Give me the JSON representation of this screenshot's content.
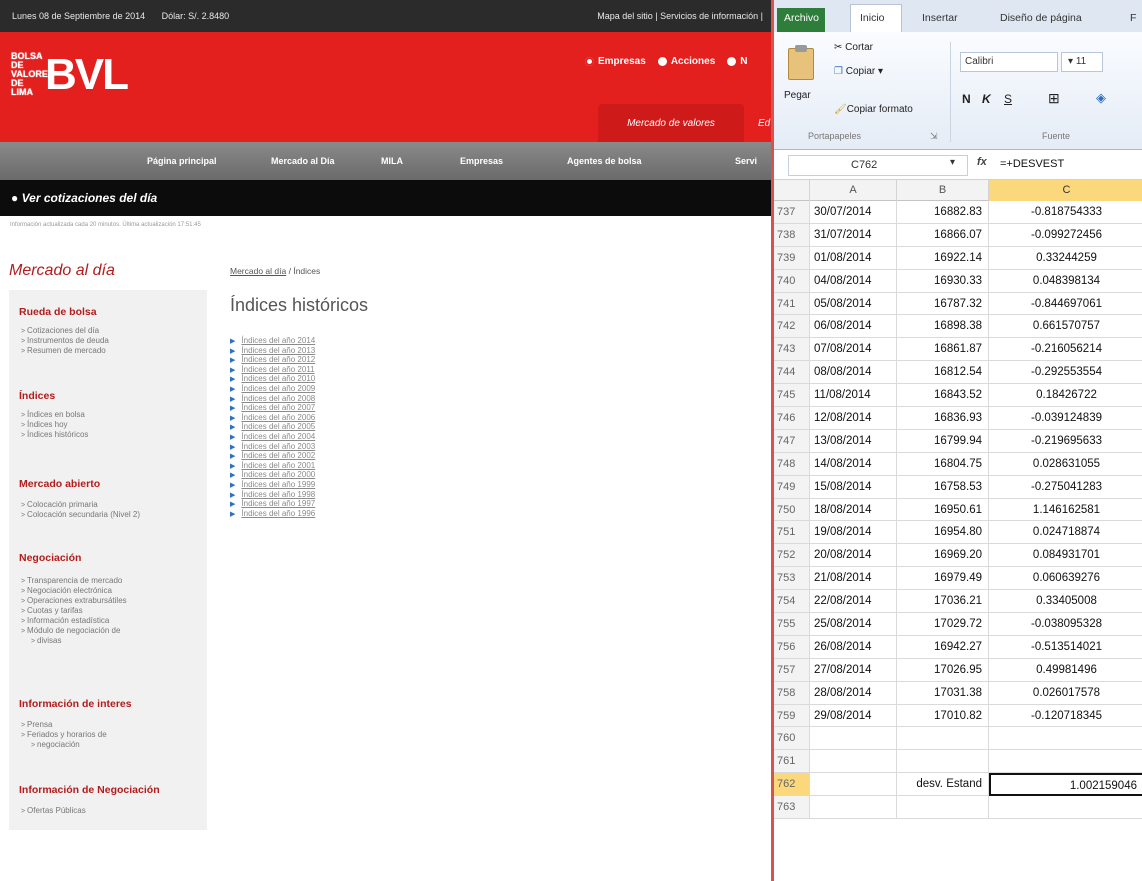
{
  "bvl": {
    "topbar": {
      "date": "Lunes 08 de Septiembre de 2014",
      "dolar": "Dólar: S/. 2.8480",
      "links": "Mapa del sitio  |  Servicios de información  |"
    },
    "logo": {
      "small": "BOLSA DE VALORES DE LIMA",
      "big": "BVL"
    },
    "radios": [
      "Empresas",
      "Acciones",
      "N"
    ],
    "tabs": {
      "active": "Mercado de valores",
      "next": "Ed"
    },
    "nav": [
      "Página principal",
      "Mercado al Día",
      "MILA",
      "Empresas",
      "Agentes de bolsa",
      "Servi"
    ],
    "banner": "Ver cotizaciones del día",
    "update_note": "Información actualizada cada 20 minutos. Última actualización 17:51:45",
    "side_title": "Mercado al día",
    "sections": [
      {
        "title": "Rueda de bolsa",
        "items": [
          "Cotizaciones del día",
          "Instrumentos de deuda",
          "Resumen de mercado"
        ]
      },
      {
        "title": "Índices",
        "items": [
          "Índices en bolsa",
          "Índices hoy",
          "Índices históricos"
        ]
      },
      {
        "title": "Mercado abierto",
        "items": [
          "Colocación primaria",
          "Colocación secundaria (Nivel 2)"
        ]
      },
      {
        "title": "Negociación",
        "items": [
          "Transparencia de mercado",
          "Negociación electrónica",
          "Operaciones extrabursátiles",
          "Cuotas y tarifas",
          "Información estadística",
          "Módulo de negociación de",
          "divisas"
        ]
      },
      {
        "title": "Información de interes",
        "items": [
          "Prensa",
          "Feriados y horarios de",
          "negociación"
        ]
      },
      {
        "title": "Información de Negociación",
        "items": [
          "Ofertas Públicas"
        ]
      }
    ],
    "breadcrumb": {
      "link": "Mercado al día",
      "sep": " / ",
      "current": "Índices"
    },
    "page_title": "Índices históricos",
    "years": [
      "Índices del año 2014",
      "Índices del año 2013",
      "Índices del año 2012",
      "Índices del año 2011",
      "Índices del año 2010",
      "Índices del año 2009",
      "Índices del año 2008",
      "Índices del año 2007",
      "Índices del año 2006",
      "Índices del año 2005",
      "Índices del año 2004",
      "Índices del año 2003",
      "Índices del año 2002",
      "Índices del año 2001",
      "Índices del año 2000",
      "Índices del año 1999",
      "Índices del año 1998",
      "Índices del año 1997",
      "Índices del año 1996"
    ]
  },
  "excel": {
    "tabs": [
      "Archivo",
      "Inicio",
      "Insertar",
      "Diseño de página",
      "F"
    ],
    "clipboard": {
      "paste": "Pegar",
      "cut": "Cortar",
      "copy": "Copiar",
      "format": "Copiar formato",
      "group": "Portapapeles"
    },
    "font": {
      "name": "Calibri",
      "size": "11",
      "group": "Fuente",
      "bold": "N",
      "italic": "K",
      "underline": "S"
    },
    "namebox": "C762",
    "fx": "fx",
    "formula": "=+DESVEST",
    "columns": [
      "A",
      "B",
      "C"
    ],
    "rows": [
      {
        "n": "737",
        "a": "30/07/2014",
        "b": "16882.83",
        "c": "-0.818754333"
      },
      {
        "n": "738",
        "a": "31/07/2014",
        "b": "16866.07",
        "c": "-0.099272456"
      },
      {
        "n": "739",
        "a": "01/08/2014",
        "b": "16922.14",
        "c": "0.33244259"
      },
      {
        "n": "740",
        "a": "04/08/2014",
        "b": "16930.33",
        "c": "0.048398134"
      },
      {
        "n": "741",
        "a": "05/08/2014",
        "b": "16787.32",
        "c": "-0.844697061"
      },
      {
        "n": "742",
        "a": "06/08/2014",
        "b": "16898.38",
        "c": "0.661570757"
      },
      {
        "n": "743",
        "a": "07/08/2014",
        "b": "16861.87",
        "c": "-0.216056214"
      },
      {
        "n": "744",
        "a": "08/08/2014",
        "b": "16812.54",
        "c": "-0.292553554"
      },
      {
        "n": "745",
        "a": "11/08/2014",
        "b": "16843.52",
        "c": "0.18426722"
      },
      {
        "n": "746",
        "a": "12/08/2014",
        "b": "16836.93",
        "c": "-0.039124839"
      },
      {
        "n": "747",
        "a": "13/08/2014",
        "b": "16799.94",
        "c": "-0.219695633"
      },
      {
        "n": "748",
        "a": "14/08/2014",
        "b": "16804.75",
        "c": "0.028631055"
      },
      {
        "n": "749",
        "a": "15/08/2014",
        "b": "16758.53",
        "c": "-0.275041283"
      },
      {
        "n": "750",
        "a": "18/08/2014",
        "b": "16950.61",
        "c": "1.146162581"
      },
      {
        "n": "751",
        "a": "19/08/2014",
        "b": "16954.80",
        "c": "0.024718874"
      },
      {
        "n": "752",
        "a": "20/08/2014",
        "b": "16969.20",
        "c": "0.084931701"
      },
      {
        "n": "753",
        "a": "21/08/2014",
        "b": "16979.49",
        "c": "0.060639276"
      },
      {
        "n": "754",
        "a": "22/08/2014",
        "b": "17036.21",
        "c": "0.33405008"
      },
      {
        "n": "755",
        "a": "25/08/2014",
        "b": "17029.72",
        "c": "-0.038095328"
      },
      {
        "n": "756",
        "a": "26/08/2014",
        "b": "16942.27",
        "c": "-0.513514021"
      },
      {
        "n": "757",
        "a": "27/08/2014",
        "b": "17026.95",
        "c": "0.49981496"
      },
      {
        "n": "758",
        "a": "28/08/2014",
        "b": "17031.38",
        "c": "0.026017578"
      },
      {
        "n": "759",
        "a": "29/08/2014",
        "b": "17010.82",
        "c": "-0.120718345"
      },
      {
        "n": "760",
        "a": "",
        "b": "",
        "c": ""
      },
      {
        "n": "761",
        "a": "",
        "b": "",
        "c": ""
      },
      {
        "n": "762",
        "a": "",
        "b": "desv. Estand",
        "c": "1.002159046"
      },
      {
        "n": "763",
        "a": "",
        "b": "",
        "c": ""
      }
    ],
    "selected_row": "762",
    "colors": {
      "accent_red": "#e4201f",
      "excel_green": "#2f7d3a",
      "selection": "#fbd87c"
    }
  }
}
